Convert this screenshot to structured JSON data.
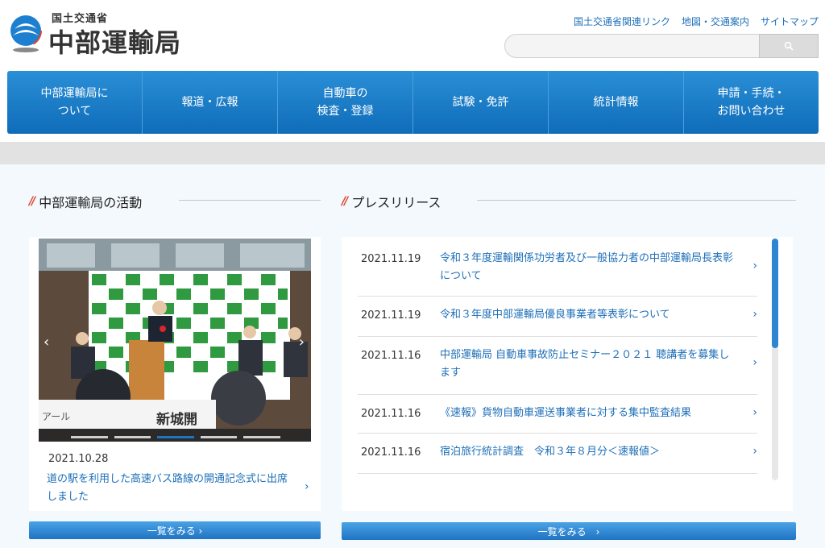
{
  "header": {
    "ministry_label": "国土交通省",
    "office_name": "中部運輸局",
    "util_links": [
      "国土交通省関連リンク",
      "地図・交通案内",
      "サイトマップ"
    ],
    "search_placeholder": ""
  },
  "nav": {
    "items": [
      "中部運輸局に\nついて",
      "報道・広報",
      "自動車の\n検査・登録",
      "試験・免許",
      "統計情報",
      "申請・手続・\nお問い合わせ"
    ]
  },
  "activities": {
    "heading": "中部運輸局の活動",
    "date": "2021.10.28",
    "title": "道の駅を利用した高速バス路線の開通記念式に出席しました",
    "more_label": "一覧をみる ›",
    "photo_sign": "新城開",
    "photo_sign_left": "アール"
  },
  "press": {
    "heading": "プレスリリース",
    "items": [
      {
        "date": "2021.11.19",
        "text": "令和３年度運輸関係功労者及び一般協力者の中部運輸局長表彰について"
      },
      {
        "date": "2021.11.19",
        "text": "令和３年度中部運輸局優良事業者等表彰について"
      },
      {
        "date": "2021.11.16",
        "text": "中部運輸局 自動車事故防止セミナー２０２１ 聴講者を募集します"
      },
      {
        "date": "2021.11.16",
        "text": "《速報》貨物自動車運送事業者に対する集中監査結果"
      },
      {
        "date": "2021.11.16",
        "text": "宿泊旅行統計調査　令和３年８月分＜速報値＞"
      }
    ],
    "more_label": "一覧をみる　›"
  },
  "colors": {
    "nav_blue": "#0f6cb9",
    "link_blue": "#1d6fb8",
    "accent_red": "#e0452c"
  }
}
